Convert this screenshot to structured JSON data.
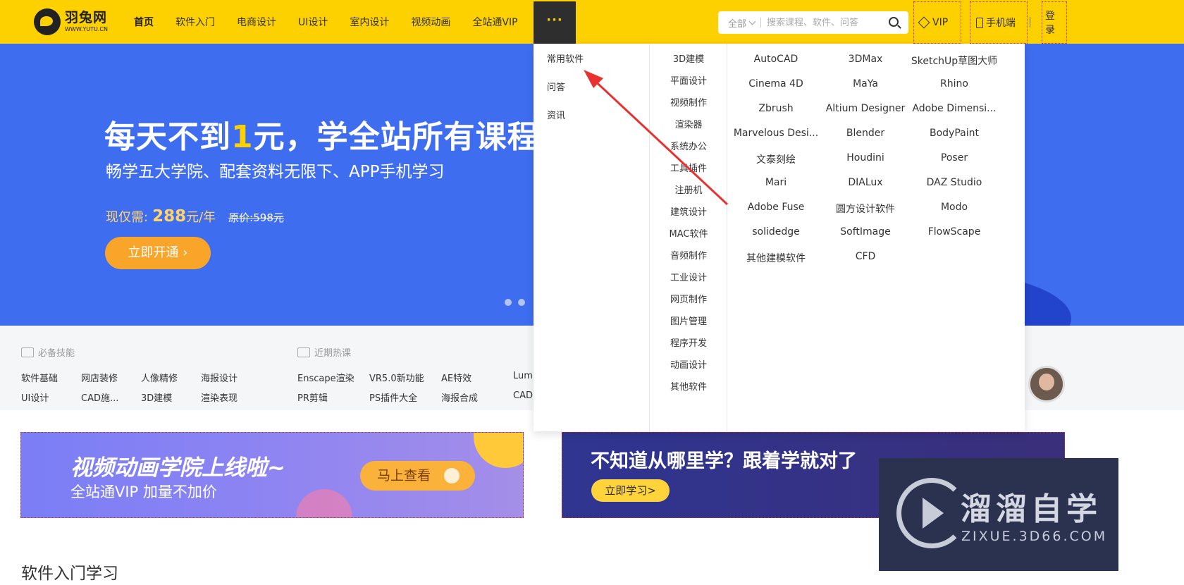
{
  "header": {
    "logo_cn": "羽兔网",
    "logo_en": "WWW.YUTU.CN",
    "nav": [
      "首页",
      "软件入门",
      "电商设计",
      "UI设计",
      "室内设计",
      "视频动画",
      "全站通VIP"
    ],
    "more_label": "···",
    "search": {
      "scope": "全部",
      "placeholder": "搜索课程、软件、问答"
    },
    "vip_label": "VIP",
    "mobile_label": "手机端",
    "login_label": "登录"
  },
  "hero": {
    "title_a": "每天不到",
    "title_highlight": "1",
    "title_b": "元，学全站所有课程",
    "subtitle": "畅学五大学院、配套资料无限下、APP手机学习",
    "price_prefix": "现仅需:",
    "price_value": "288",
    "price_unit": "元/年",
    "original_price": "原价:598元",
    "cta_label": "立即开通 ›"
  },
  "quick_links": {
    "skills_heading": "必备技能",
    "skills": [
      "软件基础",
      "网店装修",
      "人像精修",
      "海报设计",
      "UI设计",
      "CAD施...",
      "3D建模",
      "渲染表现"
    ],
    "hot_heading": "近期热课",
    "hot": [
      "Enscape渲染",
      "VR5.0新功能",
      "AE特效",
      "Lum",
      "PR剪辑",
      "PS插件大全",
      "海报合成",
      "CAD"
    ]
  },
  "promos": {
    "p1_title": "视频动画学院上线啦~",
    "p1_sub": "全站通VIP 加量不加价",
    "p1_btn": "马上查看",
    "p2_title": "不知道从哪里学？跟着学就对了",
    "p2_btn": "立即学习>"
  },
  "section_title": "软件入门学习",
  "dropdown": {
    "categories": [
      "常用软件",
      "问答",
      "资讯"
    ],
    "subcategories": [
      "3D建模",
      "平面设计",
      "视频制作",
      "渲染器",
      "系统办公",
      "工具插件",
      "注册机",
      "建筑设计",
      "MAC软件",
      "音频制作",
      "工业设计",
      "网页制作",
      "图片管理",
      "程序开发",
      "动画设计",
      "其他软件"
    ],
    "software": [
      [
        "AutoCAD",
        "3DMax",
        "SketchUp草图大师"
      ],
      [
        "Cinema 4D",
        "MaYa",
        "Rhino"
      ],
      [
        "Zbrush",
        "Altium Designer",
        "Adobe Dimensi..."
      ],
      [
        "Marvelous Desi...",
        "Blender",
        "BodyPaint"
      ],
      [
        "文泰刻绘",
        "Houdini",
        "Poser"
      ],
      [
        "Mari",
        "DIALux",
        "DAZ Studio"
      ],
      [
        "Adobe Fuse",
        "圆方设计软件",
        "Modo"
      ],
      [
        "solidedge",
        "SoftImage",
        "FlowScape"
      ],
      [
        "其他建模软件",
        "CFD"
      ]
    ]
  },
  "watermark": {
    "cn": "溜溜自学",
    "en": "ZIXUE.3D66.COM"
  },
  "colors": {
    "brand_yellow": "#fdd000",
    "hero_blue": "#3f6df0",
    "annotation_red": "#e8322f",
    "watermark_bg": "#2a3250"
  }
}
